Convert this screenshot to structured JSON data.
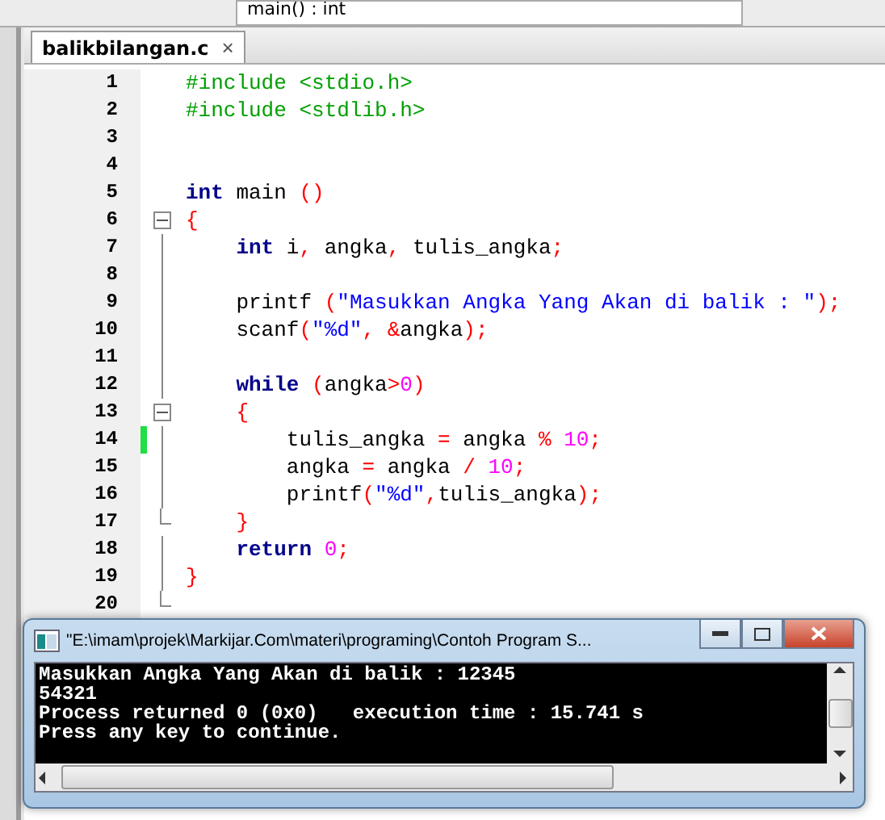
{
  "toolbar": {
    "function_dropdown": "main() : int"
  },
  "tabs": [
    {
      "label": "balikbilangan.c",
      "selected": true,
      "close": "×"
    }
  ],
  "code_lines": [
    {
      "number": "1",
      "kind": "plain",
      "modified": false,
      "tokens": [
        {
          "kind": "preproc",
          "text": "#include <stdio.h>"
        }
      ]
    },
    {
      "number": "2",
      "kind": "plain",
      "modified": false,
      "tokens": [
        {
          "kind": "preproc",
          "text": "#include <stdlib.h>"
        }
      ]
    },
    {
      "number": "3",
      "kind": "plain",
      "modified": false
    },
    {
      "number": "4",
      "kind": "plain",
      "modified": false
    },
    {
      "number": "5",
      "kind": "plain",
      "modified": false,
      "tokens": [
        {
          "kind": "keyword",
          "text": "int"
        },
        {
          "kind": "plain",
          "text": " main "
        },
        {
          "kind": "op",
          "text": "()"
        }
      ]
    },
    {
      "number": "6",
      "kind": "fold-start",
      "modified": false,
      "tokens": [
        {
          "kind": "op",
          "text": "{"
        }
      ]
    },
    {
      "number": "7",
      "kind": "fold-body",
      "modified": false,
      "tokens": [
        {
          "kind": "keyword",
          "text": "    int"
        },
        {
          "kind": "plain",
          "text": " i"
        },
        {
          "kind": "op",
          "text": ","
        },
        {
          "kind": "plain",
          "text": " angka"
        },
        {
          "kind": "op",
          "text": ","
        },
        {
          "kind": "plain",
          "text": " tulis_angka"
        },
        {
          "kind": "op",
          "text": ";"
        }
      ]
    },
    {
      "number": "8",
      "kind": "fold-body",
      "modified": false
    },
    {
      "number": "9",
      "kind": "fold-body",
      "modified": false,
      "tokens": [
        {
          "kind": "plain",
          "text": "    printf "
        },
        {
          "kind": "op",
          "text": "("
        },
        {
          "kind": "string",
          "text": "\"Masukkan Angka Yang Akan di balik : \""
        },
        {
          "kind": "op",
          "text": ");"
        }
      ]
    },
    {
      "number": "10",
      "kind": "fold-body",
      "modified": false,
      "tokens": [
        {
          "kind": "plain",
          "text": "    scanf"
        },
        {
          "kind": "op",
          "text": "("
        },
        {
          "kind": "string",
          "text": "\"%d\""
        },
        {
          "kind": "op",
          "text": ", &"
        },
        {
          "kind": "plain",
          "text": "angka"
        },
        {
          "kind": "op",
          "text": ");"
        }
      ]
    },
    {
      "number": "11",
      "kind": "fold-body",
      "modified": false
    },
    {
      "number": "12",
      "kind": "fold-body",
      "modified": false,
      "tokens": [
        {
          "kind": "keyword",
          "text": "    while "
        },
        {
          "kind": "op",
          "text": "("
        },
        {
          "kind": "plain",
          "text": "angka"
        },
        {
          "kind": "op",
          "text": ">"
        },
        {
          "kind": "number",
          "text": "0"
        },
        {
          "kind": "op",
          "text": ")"
        }
      ]
    },
    {
      "number": "13",
      "kind": "fold-start",
      "modified": false,
      "tokens": [
        {
          "kind": "op",
          "text": "    {"
        }
      ]
    },
    {
      "number": "14",
      "kind": "fold-body",
      "modified": true,
      "tokens": [
        {
          "kind": "plain",
          "text": "        tulis_angka "
        },
        {
          "kind": "op",
          "text": "="
        },
        {
          "kind": "plain",
          "text": " angka "
        },
        {
          "kind": "op",
          "text": "% "
        },
        {
          "kind": "number",
          "text": "10"
        },
        {
          "kind": "op",
          "text": ";"
        }
      ]
    },
    {
      "number": "15",
      "kind": "fold-body",
      "modified": false,
      "tokens": [
        {
          "kind": "plain",
          "text": "        angka "
        },
        {
          "kind": "op",
          "text": "="
        },
        {
          "kind": "plain",
          "text": " angka "
        },
        {
          "kind": "op",
          "text": "/ "
        },
        {
          "kind": "number",
          "text": "10"
        },
        {
          "kind": "op",
          "text": ";"
        }
      ]
    },
    {
      "number": "16",
      "kind": "fold-body",
      "modified": false,
      "tokens": [
        {
          "kind": "plain",
          "text": "        printf"
        },
        {
          "kind": "op",
          "text": "("
        },
        {
          "kind": "string",
          "text": "\"%d\""
        },
        {
          "kind": "op",
          "text": ","
        },
        {
          "kind": "plain",
          "text": "tulis_angka"
        },
        {
          "kind": "op",
          "text": ");"
        }
      ]
    },
    {
      "number": "17",
      "kind": "fold-end",
      "modified": false,
      "tokens": [
        {
          "kind": "op",
          "text": "    }"
        }
      ]
    },
    {
      "number": "18",
      "kind": "fold-body",
      "modified": false,
      "tokens": [
        {
          "kind": "keyword",
          "text": "    return "
        },
        {
          "kind": "number",
          "text": "0"
        },
        {
          "kind": "op",
          "text": ";"
        }
      ]
    },
    {
      "number": "19",
      "kind": "fold-body",
      "modified": false,
      "tokens": [
        {
          "kind": "op",
          "text": "}"
        }
      ]
    },
    {
      "number": "20",
      "kind": "fold-end",
      "modified": false
    }
  ],
  "console": {
    "title": "\"E:\\imam\\projek\\Markijar.Com\\materi\\programing\\Contoh Program S...",
    "lines": [
      "Masukkan Angka Yang Akan di balik : 12345",
      "54321",
      "Process returned 0 (0x0)   execution time : 15.741 s",
      "Press any key to continue."
    ]
  }
}
